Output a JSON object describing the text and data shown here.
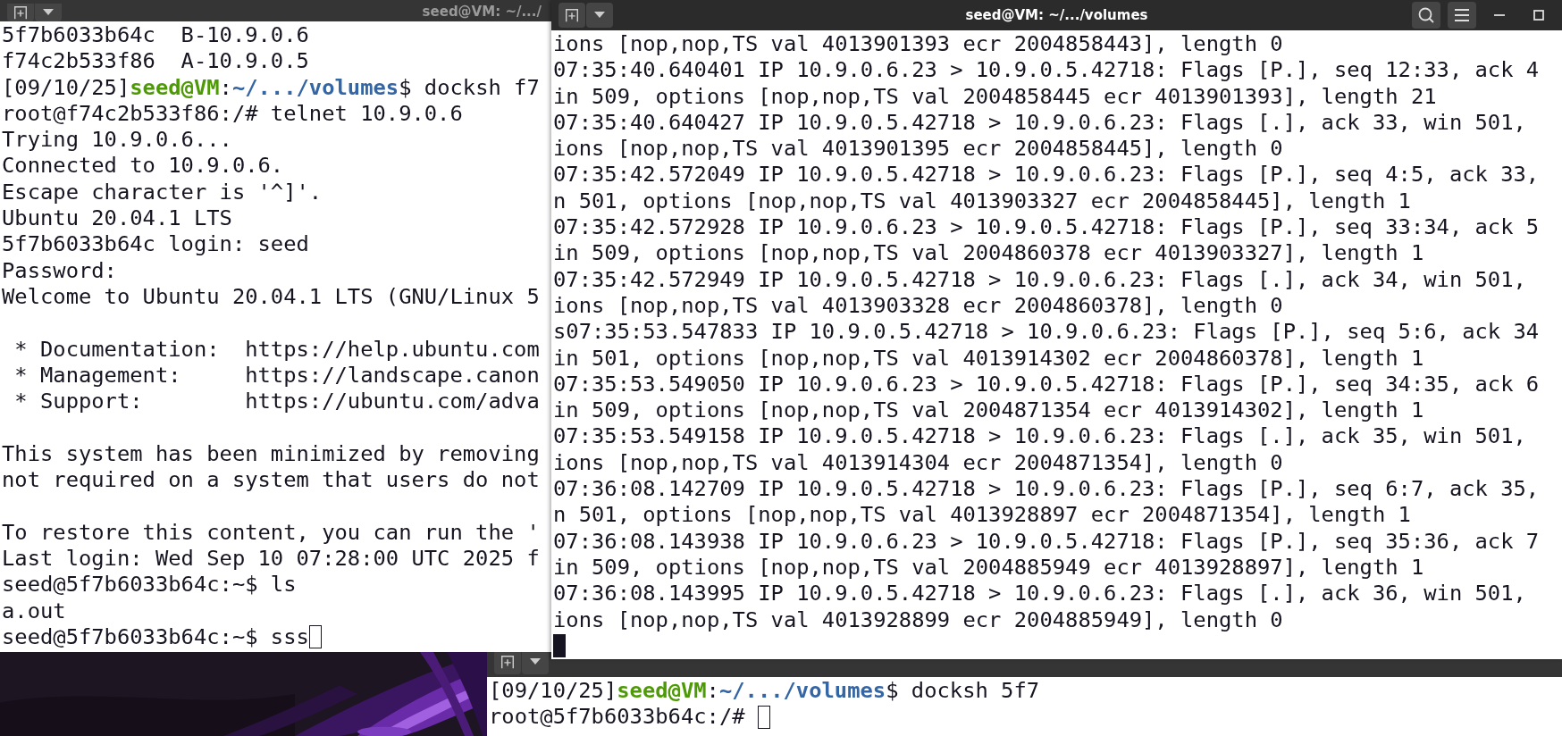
{
  "left_terminal": {
    "title": "seed@VM: ~/.../",
    "focused": false,
    "lines": [
      {
        "kind": "text",
        "text": "5f7b6033b64c  B-10.9.0.6"
      },
      {
        "kind": "text",
        "text": "f74c2b533f86  A-10.9.0.5"
      },
      {
        "kind": "prompt",
        "stamp": "[09/10/25]",
        "user": "seed@VM",
        "sep": ":",
        "path": "~/.../volumes",
        "command": "$ docksh f7"
      },
      {
        "kind": "text",
        "text": "root@f74c2b533f86:/# telnet 10.9.0.6"
      },
      {
        "kind": "text",
        "text": "Trying 10.9.0.6..."
      },
      {
        "kind": "text",
        "text": "Connected to 10.9.0.6."
      },
      {
        "kind": "text",
        "text": "Escape character is '^]'."
      },
      {
        "kind": "text",
        "text": "Ubuntu 20.04.1 LTS"
      },
      {
        "kind": "text",
        "text": "5f7b6033b64c login: seed"
      },
      {
        "kind": "text",
        "text": "Password:"
      },
      {
        "kind": "text",
        "text": "Welcome to Ubuntu 20.04.1 LTS (GNU/Linux 5"
      },
      {
        "kind": "blank"
      },
      {
        "kind": "text",
        "text": " * Documentation:  https://help.ubuntu.com"
      },
      {
        "kind": "text",
        "text": " * Management:     https://landscape.canon"
      },
      {
        "kind": "text",
        "text": " * Support:        https://ubuntu.com/adva"
      },
      {
        "kind": "blank"
      },
      {
        "kind": "text",
        "text": "This system has been minimized by removing"
      },
      {
        "kind": "text",
        "text": "not required on a system that users do not"
      },
      {
        "kind": "blank"
      },
      {
        "kind": "text",
        "text": "To restore this content, you can run the '"
      },
      {
        "kind": "text",
        "text": "Last login: Wed Sep 10 07:28:00 UTC 2025 f"
      },
      {
        "kind": "text",
        "text": "seed@5f7b6033b64c:~$ ls"
      },
      {
        "kind": "text",
        "text": "a.out"
      },
      {
        "kind": "cursor",
        "text": "seed@5f7b6033b64c:~$ sss"
      }
    ]
  },
  "right_terminal": {
    "title": "seed@VM: ~/.../volumes",
    "focused": true,
    "lines": [
      {
        "kind": "text",
        "text": "ions [nop,nop,TS val 4013901393 ecr 2004858443], length 0"
      },
      {
        "kind": "text",
        "text": "07:35:40.640401 IP 10.9.0.6.23 > 10.9.0.5.42718: Flags [P.], seq 12:33, ack 4"
      },
      {
        "kind": "text",
        "text": "in 509, options [nop,nop,TS val 2004858445 ecr 4013901393], length 21"
      },
      {
        "kind": "text",
        "text": "07:35:40.640427 IP 10.9.0.5.42718 > 10.9.0.6.23: Flags [.], ack 33, win 501,"
      },
      {
        "kind": "text",
        "text": "ions [nop,nop,TS val 4013901395 ecr 2004858445], length 0"
      },
      {
        "kind": "text",
        "text": "07:35:42.572049 IP 10.9.0.5.42718 > 10.9.0.6.23: Flags [P.], seq 4:5, ack 33,"
      },
      {
        "kind": "text",
        "text": "n 501, options [nop,nop,TS val 4013903327 ecr 2004858445], length 1"
      },
      {
        "kind": "text",
        "text": "07:35:42.572928 IP 10.9.0.6.23 > 10.9.0.5.42718: Flags [P.], seq 33:34, ack 5"
      },
      {
        "kind": "text",
        "text": "in 509, options [nop,nop,TS val 2004860378 ecr 4013903327], length 1"
      },
      {
        "kind": "text",
        "text": "07:35:42.572949 IP 10.9.0.5.42718 > 10.9.0.6.23: Flags [.], ack 34, win 501,"
      },
      {
        "kind": "text",
        "text": "ions [nop,nop,TS val 4013903328 ecr 2004860378], length 0"
      },
      {
        "kind": "text",
        "text": "s07:35:53.547833 IP 10.9.0.5.42718 > 10.9.0.6.23: Flags [P.], seq 5:6, ack 34"
      },
      {
        "kind": "text",
        "text": "in 501, options [nop,nop,TS val 4013914302 ecr 2004860378], length 1"
      },
      {
        "kind": "text",
        "text": "07:35:53.549050 IP 10.9.0.6.23 > 10.9.0.5.42718: Flags [P.], seq 34:35, ack 6"
      },
      {
        "kind": "text",
        "text": "in 509, options [nop,nop,TS val 2004871354 ecr 4013914302], length 1"
      },
      {
        "kind": "text",
        "text": "07:35:53.549158 IP 10.9.0.5.42718 > 10.9.0.6.23: Flags [.], ack 35, win 501,"
      },
      {
        "kind": "text",
        "text": "ions [nop,nop,TS val 4013914304 ecr 2004871354], length 0"
      },
      {
        "kind": "text",
        "text": "07:36:08.142709 IP 10.9.0.5.42718 > 10.9.0.6.23: Flags [P.], seq 6:7, ack 35,"
      },
      {
        "kind": "text",
        "text": "n 501, options [nop,nop,TS val 4013928897 ecr 2004871354], length 1"
      },
      {
        "kind": "text",
        "text": "07:36:08.143938 IP 10.9.0.6.23 > 10.9.0.5.42718: Flags [P.], seq 35:36, ack 7"
      },
      {
        "kind": "text",
        "text": "in 509, options [nop,nop,TS val 2004885949 ecr 4013928897], length 1"
      },
      {
        "kind": "text",
        "text": "07:36:08.143995 IP 10.9.0.5.42718 > 10.9.0.6.23: Flags [.], ack 36, win 501,"
      },
      {
        "kind": "text",
        "text": "ions [nop,nop,TS val 4013928899 ecr 2004885949], length 0"
      },
      {
        "kind": "cursor"
      }
    ]
  },
  "bottom_terminal": {
    "focused": false,
    "lines": [
      {
        "kind": "prompt",
        "stamp": "[09/10/25]",
        "user": "seed@VM",
        "sep": ":",
        "path": "~/.../volumes",
        "command": "$ docksh 5f7"
      },
      {
        "kind": "cursor",
        "text": "root@5f7b6033b64c:/# "
      }
    ]
  }
}
